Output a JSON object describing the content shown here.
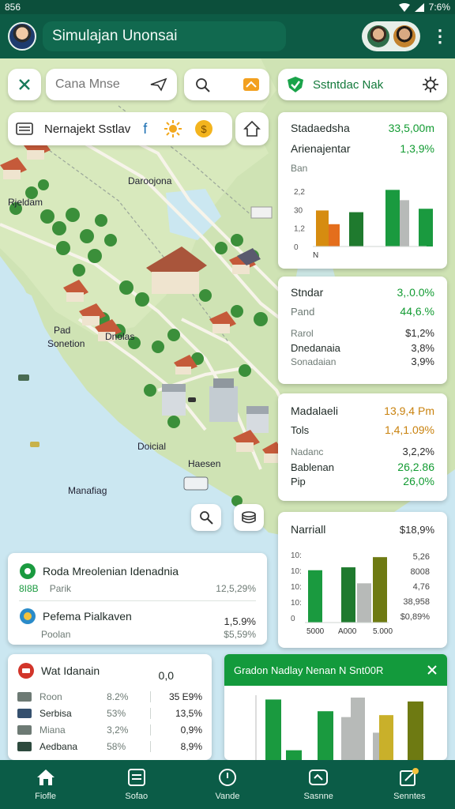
{
  "status_bar": {
    "time": "856",
    "battery": "7:6%"
  },
  "app_bar": {
    "title": "Simulajan Unonsai"
  },
  "search": {
    "placeholder": "Cana Mnse"
  },
  "top_right_chip": {
    "label": "Sstntdac Nak"
  },
  "layer_chip": {
    "label": "Nernajekt Sstlav",
    "info_glyph": "f"
  },
  "map_labels": {
    "cluster_top": "Daroojona",
    "left": "Rjeldam",
    "left_mid_1": "Pad",
    "left_mid_2": "Sonetion",
    "center": "Dnolas",
    "bottom_1": "Doicial",
    "bottom_2": "Haesen",
    "bottom_3": "Manafiag"
  },
  "panel_1": {
    "rows": [
      {
        "label": "Stadaedsha",
        "value": "33,5,00m"
      },
      {
        "label": "Arienajentar",
        "value": "1,3,9%"
      }
    ],
    "chart_label": "Ban",
    "tick_labels": [
      "2,2",
      "30",
      "1,2",
      "0"
    ],
    "x_label": "N"
  },
  "panel_2": {
    "rows": [
      {
        "label": "Stndar",
        "value": "3,.0.0%"
      },
      {
        "label": "Pand",
        "value": "44,6.%"
      }
    ],
    "subrows": [
      {
        "label": "Rarol",
        "value": "$1,2%"
      },
      {
        "label": "Dnedanaia",
        "value": "3,8%"
      },
      {
        "label": "Sonadaian",
        "value": "3,9%"
      }
    ]
  },
  "panel_3": {
    "rows": [
      {
        "label": "Madalaeli",
        "value": "13,9,4 Pm"
      },
      {
        "label": "Tols",
        "value": "1,4,1.09%"
      }
    ],
    "subrows": [
      {
        "label": "Nadanc",
        "value": "3,2,2%"
      },
      {
        "label": "Bablenan",
        "value": "26,2.86"
      },
      {
        "label": "Pip",
        "value": "26,0%"
      }
    ]
  },
  "panel_4": {
    "rows": [
      {
        "label": "Narriall",
        "value": "$18,9%"
      }
    ],
    "left_ticks": [
      "10:",
      "10:",
      "10:",
      "10:",
      "0"
    ],
    "right_values": [
      "5,26",
      "8008",
      "4,76",
      "38,958",
      "$0,89%"
    ],
    "x_labels": [
      "5000",
      "A000",
      "5.000"
    ]
  },
  "info_card": {
    "title": "Roda Mreolenian Idenadnia",
    "code": "8I8B",
    "code_right": "Parik",
    "code_value": "12,5,29%",
    "item_label": "Pefema Pialkaven",
    "item_value": "1,5.9%",
    "item_sub_left": "Poolan",
    "item_sub_right": "$5,59%"
  },
  "table_card": {
    "title": "Wat Idanain",
    "title_value": "0,0",
    "rows": [
      {
        "label": "Roon",
        "a": "8.2%",
        "b": "35 E9%"
      },
      {
        "label": "Serbisa",
        "a": "53%",
        "b": "13,5%"
      },
      {
        "label": "Miana",
        "a": "3,2%",
        "b": "0,9%"
      },
      {
        "label": "Aedbana",
        "a": "58%",
        "b": "8,9%"
      }
    ]
  },
  "popup": {
    "title": "Gradon Nadlay Nenan N Snt00R"
  },
  "bottom_nav": [
    {
      "label": "Fiofle",
      "icon": "home-icon"
    },
    {
      "label": "Sofao",
      "icon": "list-icon"
    },
    {
      "label": "Vande",
      "icon": "compass-icon"
    },
    {
      "label": "Sasnne",
      "icon": "map-icon"
    },
    {
      "label": "Senntes",
      "icon": "edit-icon"
    }
  ],
  "colors": {
    "brand": "#0d5b45",
    "accent_green": "#129b32",
    "accent_orange": "#c9820e",
    "dark_green": "#1f7a2e",
    "grey_bar": "#b7bab8",
    "olive_bar": "#6e7a12"
  },
  "chart_data": [
    {
      "type": "bar",
      "title": "",
      "categories": [
        "1",
        "2",
        "3",
        "4",
        "5",
        "6",
        "7"
      ],
      "values": [
        2.1,
        1.3,
        2.0,
        3.3,
        2.7,
        2.2,
        0
      ],
      "ylim": [
        0,
        3.5
      ]
    },
    {
      "type": "bar",
      "title": "",
      "categories": [
        "1",
        "2",
        "3",
        "4",
        "5",
        "6"
      ],
      "values": [
        3.6,
        3.8,
        2.7,
        4.5,
        0,
        0
      ],
      "x_tick_labels": [
        "5000",
        "A000",
        "5.000"
      ]
    },
    {
      "type": "bar",
      "title": "",
      "categories": [
        "1",
        "2",
        "3",
        "4",
        "5",
        "6",
        "7",
        "8"
      ],
      "values": [
        3.1,
        0.5,
        2.5,
        2.2,
        3.2,
        2.3,
        1.4,
        3.0
      ]
    }
  ]
}
